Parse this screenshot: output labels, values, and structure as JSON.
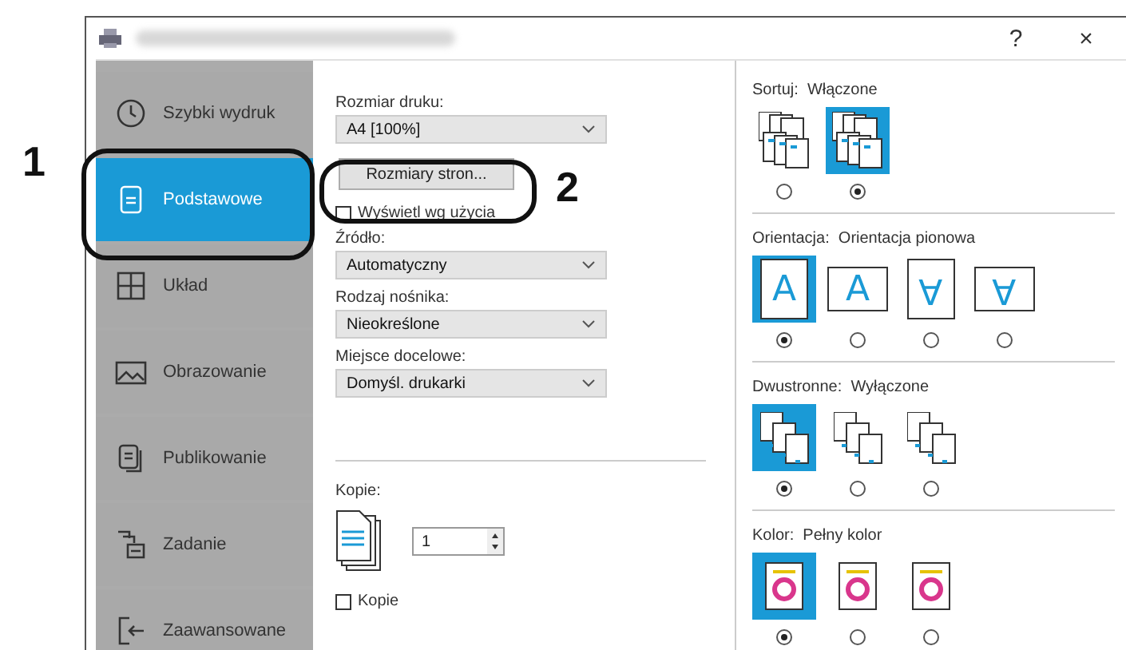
{
  "window": {
    "help": "?",
    "close": "×"
  },
  "annotations": [
    {
      "label": "1"
    },
    {
      "label": "2"
    }
  ],
  "sidebar": {
    "items": [
      {
        "label": "Szybki wydruk",
        "kind": "clock",
        "selected": false
      },
      {
        "label": "Podstawowe",
        "kind": "page",
        "selected": true
      },
      {
        "label": "Układ",
        "kind": "grid",
        "selected": false
      },
      {
        "label": "Obrazowanie",
        "kind": "image",
        "selected": false
      },
      {
        "label": "Publikowanie",
        "kind": "pages",
        "selected": false
      },
      {
        "label": "Zadanie",
        "kind": "tray",
        "selected": false
      },
      {
        "label": "Zaawansowane",
        "kind": "exit",
        "selected": false
      }
    ]
  },
  "basic": {
    "print_size": {
      "label": "Rozmiar druku:",
      "value": "A4 [100%]"
    },
    "page_sizes_button": "Rozmiary stron...",
    "show_by_usage": {
      "label": "Wyświetl wg użycia",
      "checked": false
    },
    "fields": [
      {
        "label": "Źródło:",
        "value": "Automatyczny"
      },
      {
        "label": "Rodzaj nośnika:",
        "value": "Nieokreślone"
      },
      {
        "label": "Miejsce docelowe:",
        "value": "Domyśl. drukarki"
      }
    ],
    "copies": {
      "label": "Kopie:",
      "value": "1"
    },
    "collate_check": {
      "label": "Kopie",
      "checked": false
    }
  },
  "groups": [
    {
      "kind": "collate",
      "label": "Sortuj:",
      "value": "Włączone",
      "options": [
        {
          "selected": false
        },
        {
          "selected": true
        }
      ]
    },
    {
      "kind": "orientation",
      "label": "Orientacja:",
      "value": "Orientacja pionowa",
      "options": [
        {
          "glyph": "A",
          "rotated": false,
          "landscape": false,
          "selected": true
        },
        {
          "glyph": "A",
          "rotated": false,
          "landscape": true,
          "selected": false
        },
        {
          "glyph": "A",
          "rotated": true,
          "landscape": false,
          "selected": false
        },
        {
          "glyph": "A",
          "rotated": true,
          "landscape": true,
          "selected": false
        }
      ]
    },
    {
      "kind": "duplex",
      "label": "Dwustronne:",
      "value": "Wyłączone",
      "options": [
        {
          "selected": true
        },
        {
          "selected": false
        },
        {
          "selected": false
        }
      ]
    },
    {
      "kind": "color",
      "label": "Kolor:",
      "value": "Pełny kolor",
      "options": [
        {
          "selected": true
        },
        {
          "selected": false
        },
        {
          "selected": false
        }
      ]
    }
  ]
}
